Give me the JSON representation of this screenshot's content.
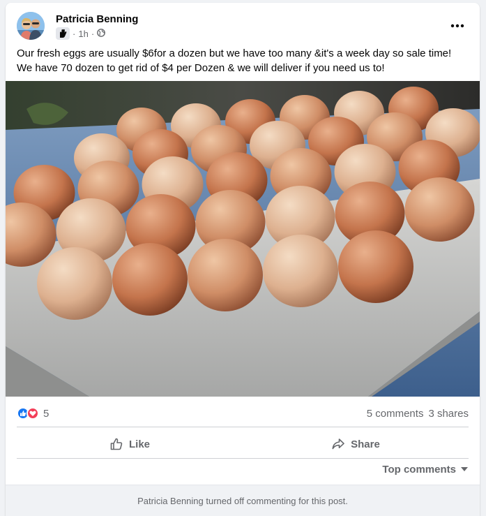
{
  "post": {
    "author": "Patricia Benning",
    "time": "1h",
    "separator": "·",
    "privacy_icon": "globe-icon",
    "author_badge_icon": "hand-badge-icon",
    "more_icon": "more-dots-icon",
    "caption_lines": [
      "Our fresh eggs are usually $6for a dozen but we have too many &it's a week day so sale time!",
      "We have 70 dozen to get rid of $4 per Dozen & we will deliver if you need us to!"
    ]
  },
  "stats": {
    "reaction_count": "5",
    "reaction_icons": [
      "like-reaction-icon",
      "love-reaction-icon"
    ],
    "comments": "5 comments",
    "shares": "3 shares"
  },
  "actions": {
    "like_label": "Like",
    "share_label": "Share"
  },
  "comments": {
    "sort_label": "Top comments",
    "disabled_notice": "Patricia Benning turned off commenting for this post."
  },
  "colors": {
    "like_blue": "#1877f2",
    "love_red": "#f33e58",
    "secondary_text": "#65676b"
  }
}
